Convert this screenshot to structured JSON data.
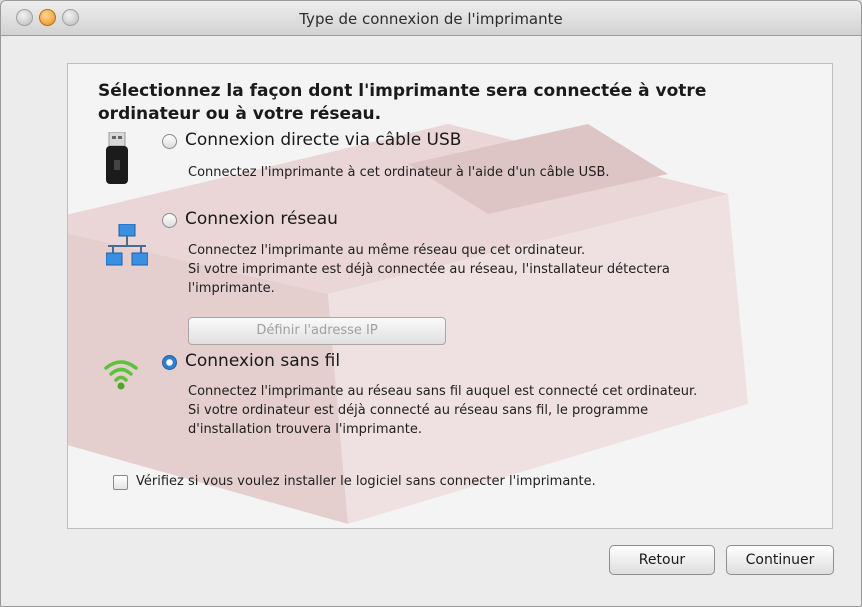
{
  "window": {
    "title": "Type de connexion de l'imprimante"
  },
  "heading": "Sélectionnez la façon dont l'imprimante sera connectée à votre ordinateur ou à votre réseau.",
  "options": [
    {
      "label": "Connexion directe via câble USB",
      "selected": false,
      "icon": "usb-icon",
      "description": [
        "Connectez l'imprimante à cet ordinateur à l'aide d'un câble USB."
      ]
    },
    {
      "label": "Connexion réseau",
      "selected": false,
      "icon": "network-icon",
      "description": [
        "Connectez l'imprimante au même réseau que cet ordinateur.",
        "Si votre imprimante est déjà connectée au réseau, l'installateur détectera",
        "l'imprimante."
      ],
      "button_label": "Définir l'adresse IP"
    },
    {
      "label": "Connexion sans fil",
      "selected": true,
      "icon": "wifi-icon",
      "description": [
        "Connectez l'imprimante au réseau sans fil auquel est connecté cet ordinateur.",
        "Si votre ordinateur est déjà connecté au réseau sans fil, le programme",
        "d'installation trouvera l'imprimante."
      ]
    }
  ],
  "checkbox": {
    "label": "Vérifiez si vous voulez installer le logiciel sans connecter l'imprimante.",
    "checked": false
  },
  "buttons": {
    "back": "Retour",
    "continue": "Continuer"
  },
  "colors": {
    "accent": "#2d7fd6",
    "wifi": "#5cc23a",
    "watermark": "#c98888"
  }
}
